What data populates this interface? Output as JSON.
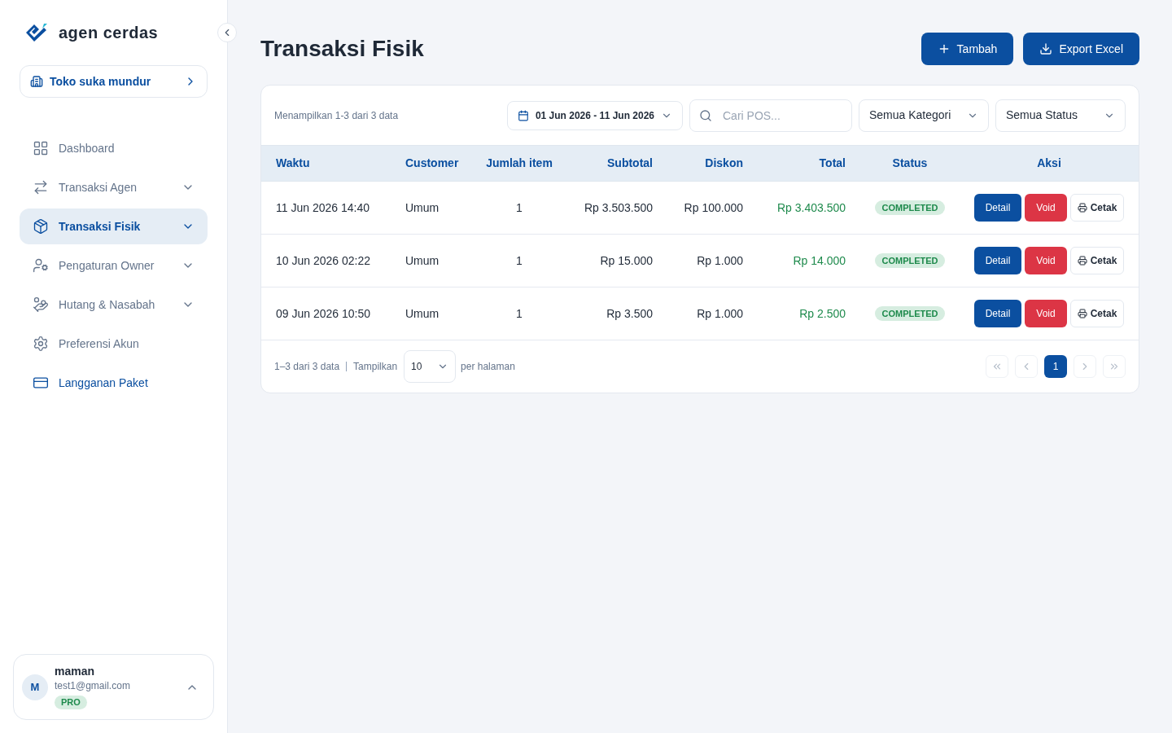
{
  "sidebar": {
    "brand": "agen cerdas",
    "store": "Toko suka mundur",
    "items": [
      {
        "label": "Dashboard",
        "selected": false,
        "expandable": false
      },
      {
        "label": "Transaksi Agen",
        "selected": false,
        "expandable": true
      },
      {
        "label": "Transaksi Fisik",
        "selected": true,
        "expandable": true
      },
      {
        "label": "Pengaturan Owner",
        "selected": false,
        "expandable": true
      },
      {
        "label": "Hutang & Nasabah",
        "selected": false,
        "expandable": true
      },
      {
        "label": "Preferensi Akun",
        "selected": false,
        "expandable": false
      },
      {
        "label": "Langganan Paket",
        "selected": false,
        "expandable": false,
        "accent": true
      }
    ],
    "user": {
      "initial": "M",
      "name": "maman",
      "email": "test1@gmail.com",
      "plan": "PRO"
    }
  },
  "page": {
    "title": "Transaksi Fisik",
    "buttons": [
      "Tambah",
      "Export Excel"
    ]
  },
  "toolbar": {
    "summary": "Menampilkan 1-3 dari 3 data",
    "date_range": "01 Jun 2026 - 11 Jun 2026",
    "search": {
      "placeholder": "Cari POS..."
    },
    "filters": [
      "Semua Kategori",
      "Semua Status"
    ]
  },
  "table": {
    "columns": [
      "Waktu",
      "Customer",
      "Jumlah item",
      "Subtotal",
      "Diskon",
      "Total",
      "Status",
      "Aksi"
    ],
    "rows": [
      {
        "waktu": "11 Jun 2026 14:40",
        "customer": "Umum",
        "jumlah": "1",
        "subtotal": "Rp 3.503.500",
        "diskon": "Rp 100.000",
        "total": "Rp 3.403.500",
        "status": "COMPLETED",
        "actions": [
          "Detail",
          "Void",
          "Cetak"
        ]
      },
      {
        "waktu": "10 Jun 2026 02:22",
        "customer": "Umum",
        "jumlah": "1",
        "subtotal": "Rp 15.000",
        "diskon": "Rp 1.000",
        "total": "Rp 14.000",
        "status": "COMPLETED",
        "actions": [
          "Detail",
          "Void",
          "Cetak"
        ]
      },
      {
        "waktu": "09 Jun 2026 10:50",
        "customer": "Umum",
        "jumlah": "1",
        "subtotal": "Rp 3.500",
        "diskon": "Rp 1.000",
        "total": "Rp 2.500",
        "status": "COMPLETED",
        "actions": [
          "Detail",
          "Void",
          "Cetak"
        ]
      }
    ]
  },
  "footer": {
    "range": "1–3 dari 3 data",
    "show_label": "Tampilkan",
    "page_size": "10",
    "per_page": "per halaman",
    "pager": [
      {
        "kind": "first",
        "disabled": true
      },
      {
        "kind": "prev",
        "disabled": true
      },
      {
        "kind": "page",
        "label": "1",
        "selected": true
      },
      {
        "kind": "next",
        "disabled": true
      },
      {
        "kind": "last",
        "disabled": true
      }
    ]
  }
}
